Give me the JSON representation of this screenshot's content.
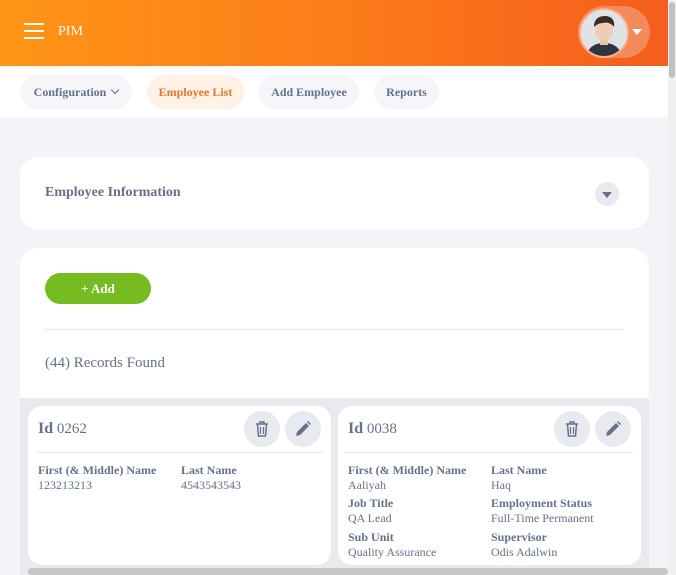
{
  "header": {
    "title": "PIM"
  },
  "nav": {
    "items": [
      {
        "label": "Configuration"
      },
      {
        "label": "Employee List"
      },
      {
        "label": "Add Employee"
      },
      {
        "label": "Reports"
      }
    ]
  },
  "filter_card": {
    "title": "Employee Information"
  },
  "list": {
    "add_label": "+  Add",
    "records_text": "(44) Records Found",
    "employees": [
      {
        "id_label": "Id",
        "id": "0262",
        "first_name_label": "First (& Middle) Name",
        "first_name": "123213213",
        "last_name_label": "Last Name",
        "last_name": "4543543543"
      },
      {
        "id_label": "Id",
        "id": "0038",
        "first_name_label": "First (& Middle) Name",
        "first_name": "Aaliyah",
        "last_name_label": "Last Name",
        "last_name": "Haq",
        "job_title_label": "Job Title",
        "job_title": "QA Lead",
        "employment_status_label": "Employment Status",
        "employment_status": "Full-Time Permanent",
        "sub_unit_label": "Sub Unit",
        "sub_unit": "Quality Assurance",
        "supervisor_label": "Supervisor",
        "supervisor": "Odis Adalwin"
      }
    ]
  },
  "colors": {
    "accent": "#ef7626",
    "add_button": "#76bc21",
    "text": "#64728c"
  },
  "icons": [
    "menu-icon",
    "avatar",
    "chevron-down-icon",
    "trash-icon",
    "pencil-icon"
  ]
}
